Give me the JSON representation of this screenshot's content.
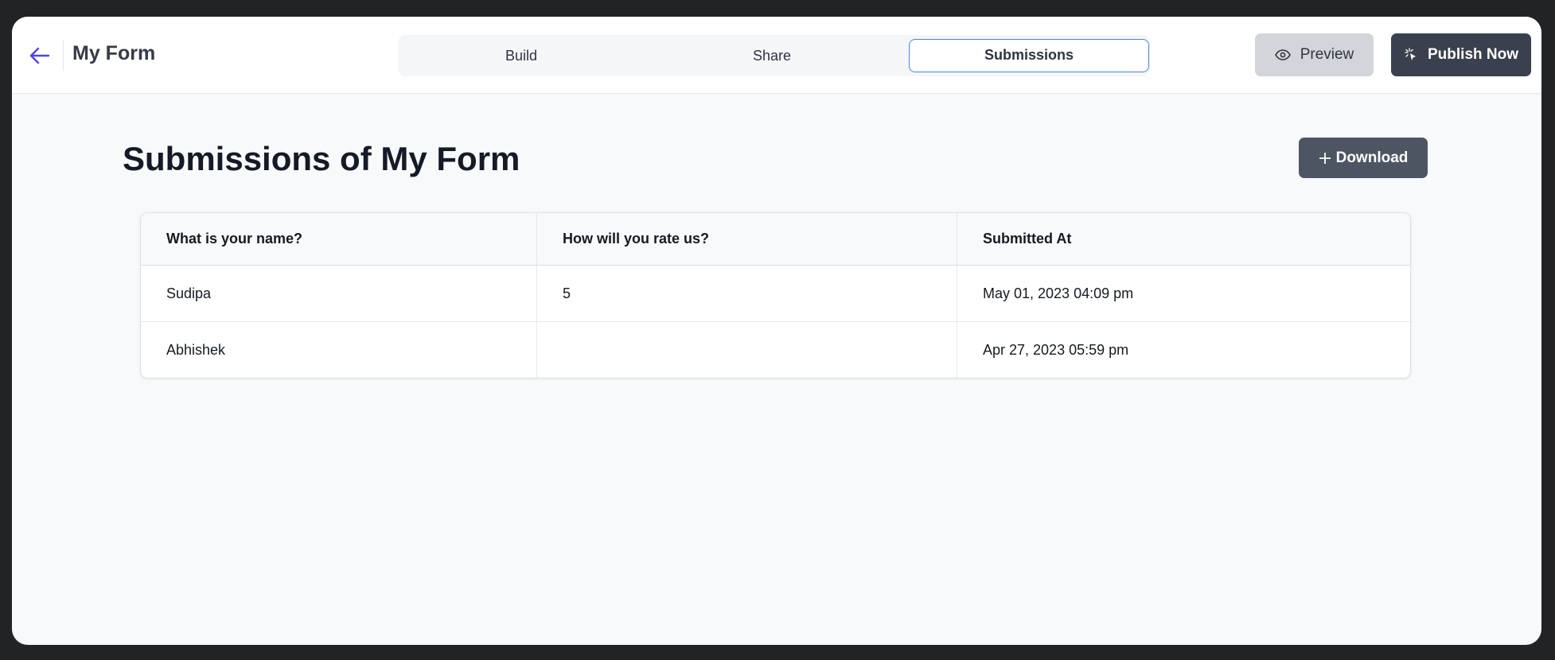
{
  "header": {
    "title": "My Form",
    "tabs": [
      {
        "label": "Build"
      },
      {
        "label": "Share"
      },
      {
        "label": "Submissions",
        "active": true
      }
    ],
    "preview_label": "Preview",
    "publish_label": "Publish Now"
  },
  "main": {
    "title": "Submissions of My Form",
    "download_label": "Download",
    "table": {
      "columns": [
        "What is your name?",
        "How will you rate us?",
        "Submitted At"
      ],
      "rows": [
        [
          "Sudipa",
          "5",
          "May 01, 2023 04:09 pm"
        ],
        [
          "Abhishek",
          "",
          "Apr 27, 2023 05:59 pm"
        ]
      ]
    }
  },
  "colors": {
    "accent": "#5046e5",
    "tab_active_border": "#4b82f0",
    "primary_button": "#3a404d"
  }
}
